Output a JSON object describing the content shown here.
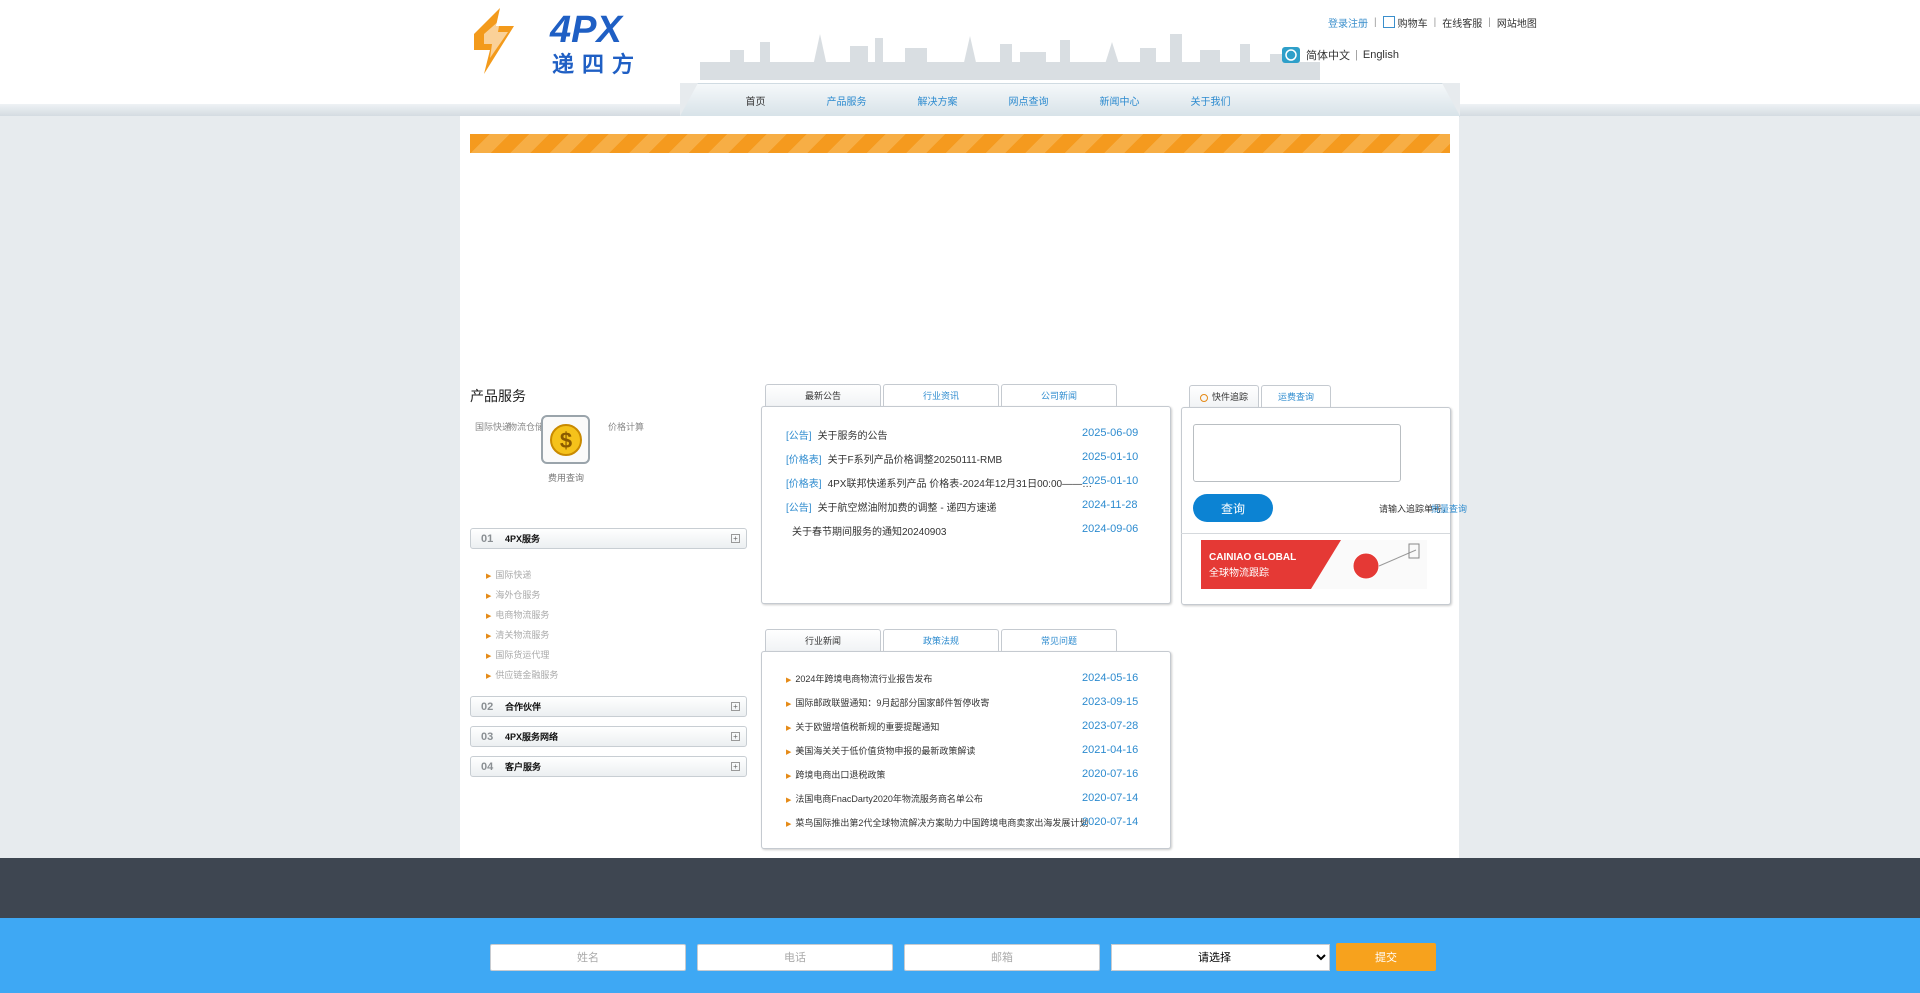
{
  "header": {
    "logo_text": "4PX",
    "logo_subtext": "递四方",
    "top_links": [
      "登录注册",
      "购物车",
      "在线客服",
      "网站地图"
    ],
    "lang": {
      "chinese": "简体中文",
      "english": "English"
    }
  },
  "nav": {
    "items": [
      "首页",
      "产品服务",
      "解决方案",
      "网点查询",
      "新闻中心",
      "关于我们"
    ]
  },
  "services": {
    "title": "产品服务",
    "labels": [
      "国际快递",
      "物流仓储",
      "费用查询",
      "价格计算"
    ]
  },
  "accordion": [
    {
      "num": "01",
      "label": "4PX服务",
      "sub": [
        "国际快递",
        "海外仓服务",
        "电商物流服务",
        "清关物流服务",
        "国际货运代理",
        "供应链金融服务"
      ]
    },
    {
      "num": "02",
      "label": "合作伙伴"
    },
    {
      "num": "03",
      "label": "4PX服务网络"
    },
    {
      "num": "04",
      "label": "客户服务"
    }
  ],
  "news_panel": {
    "tabs": [
      "最新公告",
      "行业资讯",
      "公司新闻"
    ],
    "rows": [
      {
        "tag": "[公告]",
        "title": "关于服务的公告",
        "date": "2025-06-09"
      },
      {
        "tag": "[价格表]",
        "title": "关于F系列产品价格调整20250111-RMB",
        "date": "2025-01-10"
      },
      {
        "tag": "[价格表]",
        "title": "4PX联邦快递系列产品 价格表-2024年12月31日00:00——…",
        "date": "2025-01-10"
      },
      {
        "tag": "[公告]",
        "title": "关于航空燃油附加费的调整 - 递四方速递",
        "date": "2024-11-28"
      },
      {
        "tag": "",
        "title": "关于春节期间服务的通知20240903",
        "date": "2024-09-06"
      }
    ]
  },
  "industry_panel": {
    "tabs": [
      "行业新闻",
      "政策法规",
      "常见问题"
    ],
    "rows": [
      {
        "title": "2024年跨境电商物流行业报告发布",
        "date": "2024-05-16"
      },
      {
        "title": "国际邮政联盟通知：9月起部分国家邮件暂停收寄",
        "date": "2023-09-15"
      },
      {
        "title": "关于欧盟增值税新规的重要提醒通知",
        "date": "2023-07-28"
      },
      {
        "title": "美国海关关于低价值货物申报的最新政策解读",
        "date": "2021-04-16"
      },
      {
        "title": "跨境电商出口退税政策",
        "date": "2020-07-16"
      },
      {
        "title": "法国电商FnacDarty2020年物流服务商名单公布",
        "date": "2020-07-14"
      },
      {
        "title": "菜鸟国际推出第2代全球物流解决方案助力中国跨境电商卖家出海发展计划",
        "date": "2020-07-14"
      }
    ]
  },
  "tracking": {
    "tabs": [
      "快件追踪",
      "运费查询"
    ],
    "textarea_placeholder": "",
    "button": "查询",
    "hint": "请输入追踪单号，",
    "hint_link": "批量查询",
    "cainiao_line1": "CAINIAO GLOBAL",
    "cainiao_line2": "全球物流跟踪"
  },
  "footer": {
    "inputs": [
      "姓名",
      "电话",
      "邮箱"
    ],
    "select_option": "请选择",
    "submit": "提交"
  }
}
